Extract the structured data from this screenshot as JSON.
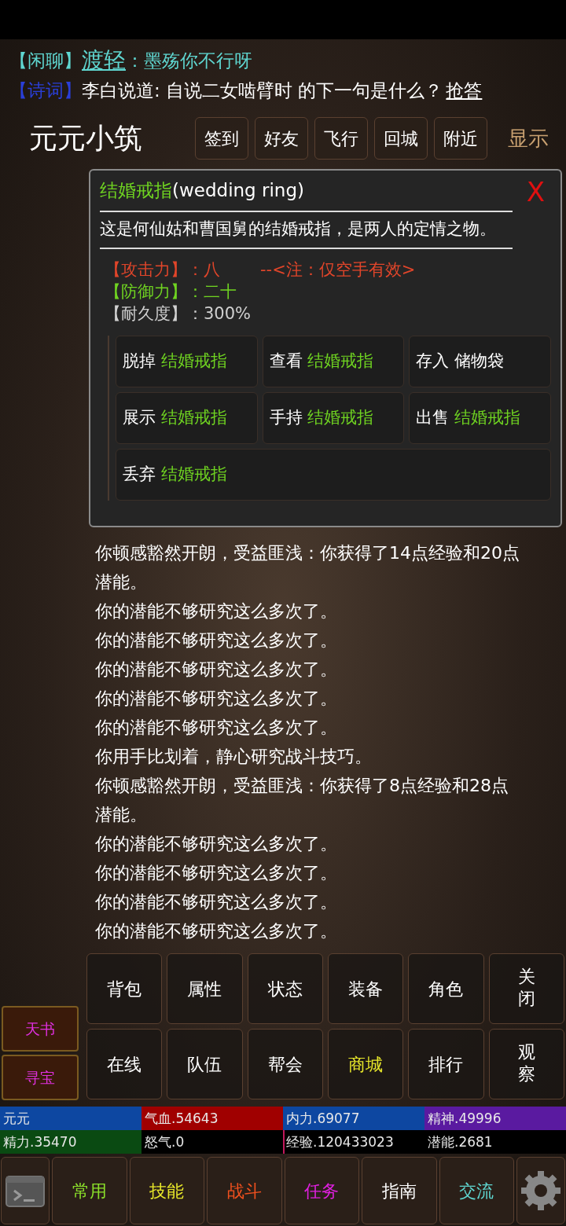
{
  "chat": [
    {
      "channel": "【闲聊】",
      "color": "#5fd6d0",
      "speaker": "渡轻",
      "text": "：墨殇你不行呀"
    },
    {
      "channel": "【诗词】",
      "color": "#2a3fd8",
      "text": "李白说道: 自说二女啮臂时 的下一句是什么？",
      "link": "抢答"
    }
  ],
  "room": {
    "title": "元元小筑",
    "buttons": [
      "签到",
      "好友",
      "飞行",
      "回城",
      "附近"
    ],
    "toggle": "显示"
  },
  "popup": {
    "item_name": "结婚戒指",
    "item_en": "(wedding ring)",
    "close": "X",
    "description": "这是何仙姑和曹国舅的结婚戒指，是两人的定情之物。",
    "stats": [
      {
        "label": "【攻击力】：",
        "value": "八",
        "color": "#e0452a",
        "note": "--<注：仅空手有效>"
      },
      {
        "label": "【防御力】：",
        "value": "二十",
        "color": "#6fd321"
      },
      {
        "label": "【耐久度】：",
        "value": "300%",
        "color": "#d0d0d0"
      }
    ],
    "actions": [
      {
        "verb": "脱掉",
        "target": "结婚戒指",
        "color": "#6fd321"
      },
      {
        "verb": "查看",
        "target": "结婚戒指",
        "color": "#6fd321"
      },
      {
        "verb": "存入",
        "target": "储物袋",
        "color": "#ffffff"
      },
      {
        "verb": "展示",
        "target": "结婚戒指",
        "color": "#6fd321"
      },
      {
        "verb": "手持",
        "target": "结婚戒指",
        "color": "#6fd321"
      },
      {
        "verb": "出售",
        "target": "结婚戒指",
        "color": "#6fd321"
      },
      {
        "verb": "丢弃",
        "target": "结婚戒指",
        "color": "#6fd321"
      }
    ]
  },
  "log": [
    "你顿感豁然开朗，受益匪浅：你获得了14点经验和20点潜能。",
    "你的潜能不够研究这么多次了。",
    "你的潜能不够研究这么多次了。",
    "你的潜能不够研究这么多次了。",
    "你的潜能不够研究这么多次了。",
    "你的潜能不够研究这么多次了。",
    "你用手比划着，静心研究战斗技巧。",
    "你顿感豁然开朗，受益匪浅：你获得了8点经验和28点潜能。",
    "你的潜能不够研究这么多次了。",
    "你的潜能不够研究这么多次了。",
    "你的潜能不够研究这么多次了。",
    "你的潜能不够研究这么多次了。"
  ],
  "side_buttons": [
    "天书",
    "寻宝"
  ],
  "menu": [
    {
      "label": "背包",
      "color": "#ffffff"
    },
    {
      "label": "属性",
      "color": "#ffffff"
    },
    {
      "label": "状态",
      "color": "#ffffff"
    },
    {
      "label": "装备",
      "color": "#ffffff"
    },
    {
      "label": "角色",
      "color": "#ffffff"
    },
    {
      "label": "关闭",
      "color": "#ffffff"
    },
    {
      "label": "在线",
      "color": "#ffffff"
    },
    {
      "label": "队伍",
      "color": "#ffffff"
    },
    {
      "label": "帮会",
      "color": "#ffffff"
    },
    {
      "label": "商城",
      "color": "#e6e62a"
    },
    {
      "label": "排行",
      "color": "#ffffff"
    },
    {
      "label": "观察",
      "color": "#ffffff"
    }
  ],
  "stats_bars": [
    {
      "label": "元元",
      "level": 1,
      "color": "#0d47a1"
    },
    {
      "label": "气血.54643",
      "level": 1,
      "color": "#a00000"
    },
    {
      "label": "内力.69077",
      "level": 1,
      "color": "#0d47a1"
    },
    {
      "label": "精神.49996",
      "level": 1,
      "color": "#5a1aa0"
    },
    {
      "label": "精力.35470",
      "level": 1,
      "color": "#0a4a12"
    },
    {
      "label": "怒气.0"
    },
    {
      "label": "经验.120433023",
      "level": 0.01,
      "color": "#c2185b"
    },
    {
      "label": "潜能.2681"
    }
  ],
  "tabs": [
    {
      "label": "常用",
      "color": "#8be02a"
    },
    {
      "label": "技能",
      "color": "#e8e82a"
    },
    {
      "label": "战斗",
      "color": "#f0501e"
    },
    {
      "label": "任务",
      "color": "#e020e0"
    },
    {
      "label": "指南",
      "color": "#ffffff"
    },
    {
      "label": "交流",
      "color": "#5fd6d0"
    }
  ]
}
